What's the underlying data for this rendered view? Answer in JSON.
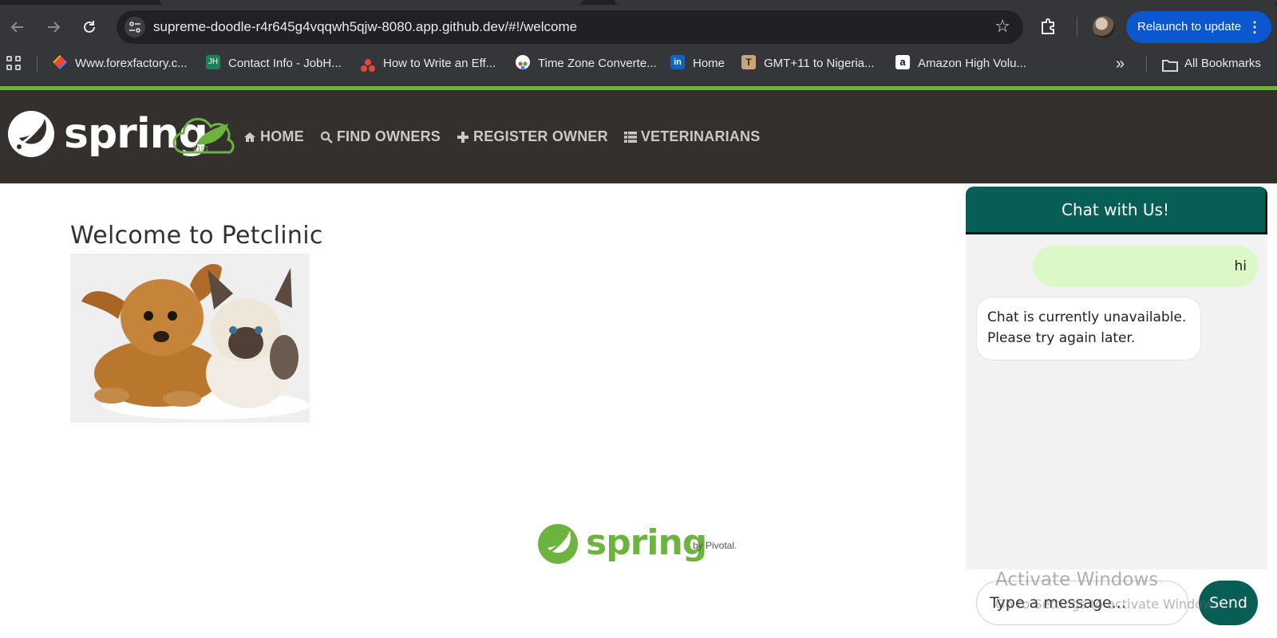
{
  "browser": {
    "url": "supreme-doodle-r4r645g4vqqwh5qjw-8080.app.github.dev/#!/welcome",
    "relaunch_label": "Relaunch to update",
    "bookmarks": [
      {
        "label": "Www.forexfactory.c...",
        "icon": "forexfactory-favicon",
        "color": "#e8473b"
      },
      {
        "label": "Contact Info - JobH...",
        "icon": "jobhunt-favicon",
        "color": "#1a7f5a"
      },
      {
        "label": "How to Write an Eff...",
        "icon": "three-dots-favicon",
        "color": "#e8473b"
      },
      {
        "label": "Time Zone Converte...",
        "icon": "timezone-favicon",
        "color": "#ffffff"
      },
      {
        "label": "Home",
        "icon": "linkedin-icon",
        "color": "#0a66c2"
      },
      {
        "label": "GMT+11 to Nigeria...",
        "icon": "timeanddate-favicon",
        "color": "#c8a57a"
      },
      {
        "label": "Amazon High Volu...",
        "icon": "amazon-icon",
        "color": "#ffffff"
      }
    ],
    "all_bookmarks_label": "All Bookmarks"
  },
  "site": {
    "logo_text": "spring",
    "nav": [
      {
        "label": "HOME",
        "icon": "home-icon"
      },
      {
        "label": "FIND OWNERS",
        "icon": "search-icon"
      },
      {
        "label": "REGISTER OWNER",
        "icon": "plus-icon"
      },
      {
        "label": "VETERINARIANS",
        "icon": "list-icon"
      }
    ],
    "title": "Welcome to Petclinic",
    "footer_logo_text": "spring",
    "footer_by": "by Pivotal."
  },
  "chat": {
    "header": "Chat with Us!",
    "messages": [
      {
        "from": "user",
        "text": "hi"
      },
      {
        "from": "bot",
        "text": "Chat is currently unavailable. Please try again later."
      }
    ],
    "input_placeholder": "Type a message...",
    "send_label": "Send"
  },
  "watermark": {
    "line1": "Activate Windows",
    "line2": "Go to Settings to activate Windows."
  },
  "colors": {
    "spring_green": "#6db33f",
    "navbar": "#34302d",
    "chat_header": "#075e54",
    "user_bubble": "#dcf8c6",
    "relaunch": "#0b57d0"
  }
}
